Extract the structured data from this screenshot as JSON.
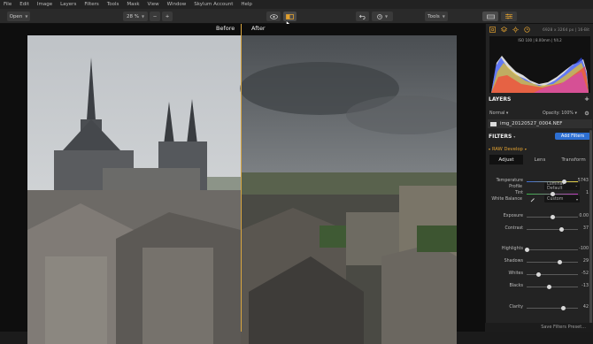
{
  "menu": [
    "File",
    "Edit",
    "Image",
    "Layers",
    "Filters",
    "Tools",
    "Mask",
    "View",
    "Window",
    "Skylum Account",
    "Help"
  ],
  "toolbar": {
    "open_label": "Open",
    "zoom_value": "28 %",
    "zoom_out": "−",
    "zoom_in": "+",
    "tools_label": "Tools"
  },
  "canvas": {
    "before_label": "Before",
    "after_label": "After"
  },
  "panel": {
    "image_info": "6928 x 3264 px  |  16-Bit",
    "histo_info": "ISO 100  |  8.00mm  |  f/4.2",
    "layers_title": "LAYERS",
    "blend_mode": "Normal",
    "opacity_label": "Opacity: 100%",
    "layer_name": "img_20120527_0004.NEF",
    "filters_title": "FILTERS",
    "add_filters": "Add Filters",
    "raw_develop": "RAW Develop",
    "tabs": [
      "Adjust",
      "Lens",
      "Transform"
    ],
    "profile_label": "Profile",
    "profile_value": "Luminar Default",
    "wb_label": "White Balance",
    "wb_value": "Custom",
    "sliders": [
      {
        "label": "Temperature",
        "value": "5743",
        "pos": 0.74,
        "gradient": "temp"
      },
      {
        "label": "Tint",
        "value": "1",
        "pos": 0.5,
        "gradient": "tint"
      },
      {
        "label": "Exposure",
        "value": "0.00",
        "pos": 0.5,
        "gradient": "none"
      },
      {
        "label": "Contrast",
        "value": "37",
        "pos": 0.68,
        "gradient": "none"
      },
      {
        "label": "Highlights",
        "value": "-100",
        "pos": 0.0,
        "gradient": "none"
      },
      {
        "label": "Shadows",
        "value": "29",
        "pos": 0.64,
        "gradient": "none"
      },
      {
        "label": "Whites",
        "value": "-52",
        "pos": 0.24,
        "gradient": "none"
      },
      {
        "label": "Blacks",
        "value": "-13",
        "pos": 0.44,
        "gradient": "none"
      },
      {
        "label": "Clarity",
        "value": "42",
        "pos": 0.71,
        "gradient": "none"
      }
    ],
    "save_preset": "Save Filters Preset..."
  },
  "colors": {
    "accent": "#2d6fd2",
    "split_line": "#d9a640",
    "active_tab": "#e0a030"
  }
}
